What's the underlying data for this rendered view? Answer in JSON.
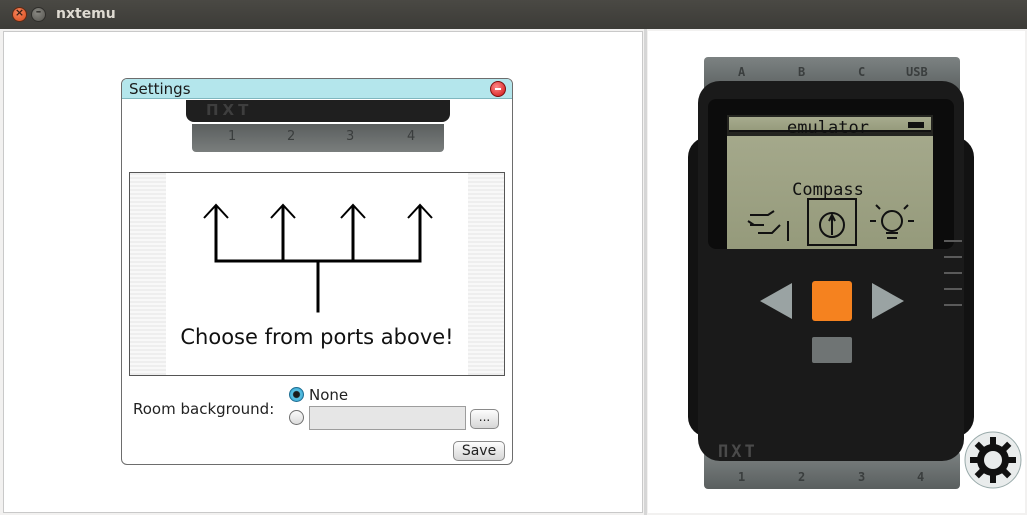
{
  "window": {
    "title": "nxtemu"
  },
  "dialog": {
    "title": "Settings",
    "brick_logo": "ПXT",
    "ports": [
      "1",
      "2",
      "3",
      "4"
    ],
    "port_panel_text": "Choose from ports above!",
    "room_background_label": "Room background:",
    "option_none_label": "None",
    "option_none_selected": true,
    "path_value": "",
    "browse_label": "...",
    "save_label": "Save"
  },
  "brick": {
    "top_ports": [
      "A",
      "B",
      "C",
      "USB"
    ],
    "bottom_ports": [
      "1",
      "2",
      "3",
      "4"
    ],
    "logo": "ПXT",
    "screen_title": "emulator",
    "menu_selected": "Compass",
    "menu_icons": [
      "hand-icon",
      "compass-icon",
      "bulb-icon"
    ],
    "button_colors": {
      "enter": "#f5821f",
      "arrows": "#9aa3a3",
      "back": "#6f7474"
    }
  },
  "settings_icon": "gear-icon"
}
